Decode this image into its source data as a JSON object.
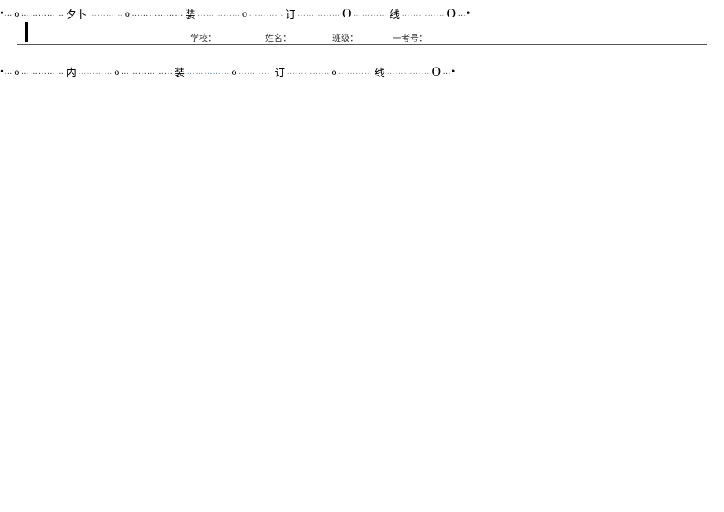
{
  "topLine": {
    "startBullet": "•",
    "dots1": "…",
    "o1": "o",
    "dots2": "……………",
    "char1": "夕卜",
    "dots3": "…………",
    "o2": "o",
    "dots4": "………………",
    "char2": "装",
    "dots5": "……………",
    "o3": "o",
    "dots6": "…………",
    "char3": "订",
    "dots7": "……………",
    "o4": "O",
    "dots8": "…………",
    "char4": "线",
    "dots9": "……………",
    "o5": "O",
    "dots10": "…",
    "endBullet": "•"
  },
  "bottomLine": {
    "startBullet": "•",
    "dots1": "…",
    "o1": "o",
    "dots2": "……………",
    "char1": "内",
    "dots3": "…………",
    "o2": "o",
    "dots4": "………………",
    "char2": "装",
    "dots5": "……………",
    "o3": "o",
    "dots6": "…………",
    "char3": "订",
    "dots7": "……………",
    "o4": "o",
    "dots8": "…………",
    "char4": "线",
    "dots9": "……………",
    "o5": "O",
    "dots10": "…",
    "endBullet": "•"
  },
  "form": {
    "school": "学校：",
    "name": "姓名：",
    "class": "班级：",
    "examPrefix": "一",
    "examNo": "考号：",
    "dashEnd": "—"
  }
}
